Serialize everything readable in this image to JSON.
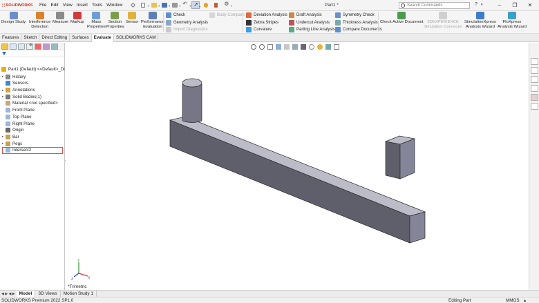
{
  "app": {
    "brand": "SOLIDWORKS",
    "document_title": "Part1 *"
  },
  "menu": [
    "File",
    "Edit",
    "View",
    "Insert",
    "Tools",
    "Window"
  ],
  "search": {
    "placeholder": "Search Commands"
  },
  "ribbon": {
    "large": [
      {
        "label": "Design Study",
        "icon": "design-study-icon",
        "disabled": false
      },
      {
        "label": "Interference\nDetection",
        "icon": "interference-detection-icon",
        "disabled": false
      },
      {
        "label": "Measure",
        "icon": "measure-icon",
        "disabled": false
      },
      {
        "label": "Markup",
        "icon": "markup-icon",
        "disabled": false
      },
      {
        "label": "Mass\nProperties",
        "icon": "mass-properties-icon",
        "disabled": false
      },
      {
        "label": "Section\nProperties",
        "icon": "section-properties-icon",
        "disabled": false
      },
      {
        "label": "Sensor",
        "icon": "sensor-icon",
        "disabled": false
      },
      {
        "label": "Performance\nEvaluation",
        "icon": "performance-evaluation-icon",
        "disabled": false
      }
    ],
    "small_col1": [
      {
        "label": "Check",
        "icon": "check-icon",
        "disabled": false
      },
      {
        "label": "Geometry Analysis",
        "icon": "geometry-analysis-icon",
        "disabled": false
      },
      {
        "label": "Import Diagnostics",
        "icon": "import-diagnostics-icon",
        "disabled": true
      }
    ],
    "body_compare": {
      "label": "Body Compare",
      "icon": "body-compare-icon",
      "disabled": true
    },
    "small_col2": [
      {
        "label": "Deviation Analysis",
        "icon": "deviation-analysis-icon",
        "disabled": false
      },
      {
        "label": "Zebra Stripes",
        "icon": "zebra-stripes-icon",
        "disabled": false
      },
      {
        "label": "Curvature",
        "icon": "curvature-icon",
        "disabled": false
      }
    ],
    "small_col3": [
      {
        "label": "Draft Analysis",
        "icon": "draft-analysis-icon",
        "disabled": false
      },
      {
        "label": "Undercut Analysis",
        "icon": "undercut-analysis-icon",
        "disabled": false
      },
      {
        "label": "Parting Line Analysis",
        "icon": "parting-line-analysis-icon",
        "disabled": false
      }
    ],
    "small_col4": [
      {
        "label": "Symmetry Check",
        "icon": "symmetry-check-icon",
        "disabled": false
      },
      {
        "label": "Thickness Analysis",
        "icon": "thickness-analysis-icon",
        "disabled": false
      },
      {
        "label": "Compare Documents",
        "icon": "compare-documents-icon",
        "disabled": false
      }
    ],
    "right_large": [
      {
        "label": "Check Active Document",
        "icon": "check-active-document-icon",
        "disabled": false
      },
      {
        "label": "3DEXPERIENCE\nSimulation Connector",
        "icon": "simulation-connector-icon",
        "disabled": true
      },
      {
        "label": "SimulationXpress\nAnalysis Wizard",
        "icon": "simulationxpress-icon",
        "disabled": false
      },
      {
        "label": "FloXpress\nAnalysis Wizard",
        "icon": "floxpress-icon",
        "disabled": false
      }
    ]
  },
  "tabs": [
    "Features",
    "Sketch",
    "Direct Editing",
    "Surfaces",
    "Evaluate",
    "SOLIDWORKS CAM"
  ],
  "active_tab": "Evaluate",
  "tree": {
    "root": "Part1 (Default) <<Default>_Di",
    "items": [
      {
        "label": "History",
        "icon": "history-icon",
        "expandable": true
      },
      {
        "label": "Sensors",
        "icon": "sensors-icon",
        "expandable": false
      },
      {
        "label": "Annotations",
        "icon": "annotations-icon",
        "expandable": true
      },
      {
        "label": "Solid Bodies(1)",
        "icon": "solid-bodies-icon",
        "expandable": true
      },
      {
        "label": "Material <not specified>",
        "icon": "material-icon",
        "expandable": false
      },
      {
        "label": "Front Plane",
        "icon": "plane-icon",
        "expandable": false
      },
      {
        "label": "Top Plane",
        "icon": "plane-icon",
        "expandable": false
      },
      {
        "label": "Right Plane",
        "icon": "plane-icon",
        "expandable": false
      },
      {
        "label": "Origin",
        "icon": "origin-icon",
        "expandable": false
      },
      {
        "label": "Bar",
        "icon": "extrude-icon",
        "expandable": true
      },
      {
        "label": "Pegs",
        "icon": "extrude-icon",
        "expandable": true
      },
      {
        "label": "Intersect2",
        "icon": "intersect-icon",
        "expandable": false
      }
    ],
    "selected": "Intersect2"
  },
  "viewport": {
    "view_label": "*Trimetric",
    "model": "bar-with-pegs"
  },
  "bottom_tabs": [
    "Model",
    "3D Views",
    "Motion Study 1"
  ],
  "active_bottom_tab": "Model",
  "status": {
    "left": "SOLIDWORKS Premium 2022 SP1.0",
    "mode": "Editing Part",
    "units": "MMGS"
  },
  "colors": {
    "brand_red": "#d52b1e",
    "model_face_top": "#babac6",
    "model_face_front": "#6b6b78",
    "model_face_side": "#8a8a98",
    "selection_box": "#d9534f"
  }
}
